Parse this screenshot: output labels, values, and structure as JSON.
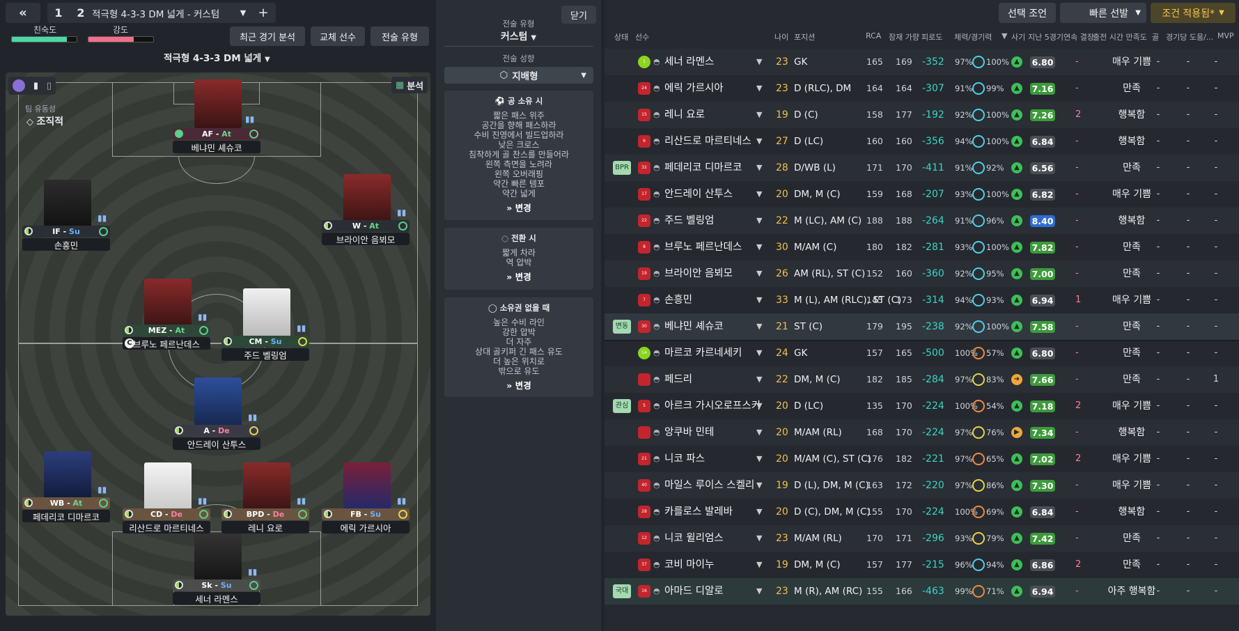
{
  "header": {
    "back_label": "«",
    "tab1": "1",
    "tab2": "2",
    "tactic_title": "적극형 4-3-3 DM 넓게 - 커스텀",
    "add_label": "+"
  },
  "meters": {
    "familiarity_label": "친숙도",
    "familiarity_value": 0.85,
    "intensity_label": "강도",
    "intensity_value": 0.7,
    "familiarity_color": "#4cd7a6",
    "intensity_color": "#ef6f8c"
  },
  "actions": {
    "recent_match": "최근 경기 분석",
    "substitutes": "교체 선수",
    "tactic_style": "전술 유형"
  },
  "formation": {
    "name": "적극형 4-3-3 DM 넓게",
    "analysis_label": "분석",
    "fluidity_label": "팀 유동성",
    "fluidity_value": "조직적"
  },
  "pitch_players": [
    {
      "role": "AF",
      "duty": "At",
      "name": "베냐민 셰슈코",
      "captain": false
    },
    {
      "role": "IF",
      "duty": "Su",
      "name": "손흥민",
      "captain": false
    },
    {
      "role": "W",
      "duty": "At",
      "name": "브라이안 음뵈모",
      "captain": false
    },
    {
      "role": "MEZ",
      "duty": "At",
      "name": "브루노 페르난데스",
      "captain": true
    },
    {
      "role": "CM",
      "duty": "Su",
      "name": "주드 벨링엄",
      "captain": false
    },
    {
      "role": "A",
      "duty": "De",
      "name": "안드레이 산투스",
      "captain": false
    },
    {
      "role": "WB",
      "duty": "At",
      "name": "페데리코 디마르코",
      "captain": false
    },
    {
      "role": "CD",
      "duty": "De",
      "name": "리산드로 마르티네스",
      "captain": false
    },
    {
      "role": "BPD",
      "duty": "De",
      "name": "레니 요로",
      "captain": false
    },
    {
      "role": "FB",
      "duty": "Su",
      "name": "에릭 가르시아",
      "captain": false
    },
    {
      "role": "Sk",
      "duty": "Su",
      "name": "세너 라멘스",
      "captain": false
    }
  ],
  "mid_panel": {
    "close_label": "닫기",
    "tactic_type_label": "전술 유형",
    "tactic_type_value": "커스텀",
    "mentality_label": "전술 성향",
    "mentality_value": "지배형",
    "in_possession": {
      "title": "공 소유 시",
      "items": [
        "짧은 패스 위주",
        "공간을 향해 패스하라",
        "수비 진영에서 빌드업하라",
        "낮은 크로스",
        "침착하게 골 찬스를 만들어라",
        "왼쪽 측면을 노려라",
        "왼쪽 오버래핑",
        "약간 빠른 템포",
        "약간 넓게"
      ],
      "change": "변경"
    },
    "transition": {
      "title": "전환 시",
      "items": [
        "짧게 차라",
        "역 압박"
      ],
      "change": "변경"
    },
    "out_of_possession": {
      "title": "소유권 없을 때",
      "items": [
        "높은 수비 라인",
        "강한 압박",
        "더 자주",
        "상대 골키퍼 긴 패스 유도",
        "더 높은 위치로",
        "밖으로 유도"
      ],
      "change": "변경"
    }
  },
  "top_right": {
    "selection_advice": "선택 조언",
    "quick_pick": "빠른 선발",
    "filter": "조건 적용됨*"
  },
  "table": {
    "headers": [
      "상태",
      "선수",
      "나이",
      "포지션",
      "RCA",
      "잠재 가량",
      "피로도",
      "체력/경기력",
      "사기",
      "지난 5경기",
      "연속 결장",
      "출전 시간 만족도",
      "골",
      "경기당 도움/...",
      "MVP"
    ],
    "rows": [
      {
        "tag": "",
        "num": "1",
        "gk": true,
        "name": "세너 라멘스",
        "age": "23",
        "pos": "GK",
        "rca": "165",
        "pot": "169",
        "fat": "-352",
        "cond": "97%",
        "sharp": "100%",
        "morale": "up",
        "rating": "6.80",
        "rc": "grey",
        "streak": "-",
        "sat": "매우 기쁨",
        "g": "-",
        "a": "-",
        "mvp": "-"
      },
      {
        "tag": "",
        "num": "24",
        "gk": false,
        "name": "에릭 가르시아",
        "age": "23",
        "pos": "D (RLC), DM",
        "rca": "164",
        "pot": "164",
        "fat": "-307",
        "cond": "91%",
        "sharp": "99%",
        "morale": "up",
        "rating": "7.16",
        "rc": "green",
        "streak": "-",
        "sat": "만족",
        "g": "-",
        "a": "-",
        "mvp": "-"
      },
      {
        "tag": "",
        "num": "15",
        "gk": false,
        "name": "레니 요로",
        "age": "19",
        "pos": "D (C)",
        "rca": "158",
        "pot": "177",
        "fat": "-192",
        "cond": "92%",
        "sharp": "100%",
        "morale": "up",
        "rating": "7.26",
        "rc": "green",
        "streak": "2",
        "sat": "행복함",
        "g": "-",
        "a": "-",
        "mvp": "-"
      },
      {
        "tag": "",
        "num": "6",
        "gk": false,
        "name": "리산드로 마르티네스",
        "age": "27",
        "pos": "D (LC)",
        "rca": "160",
        "pot": "160",
        "fat": "-356",
        "cond": "94%",
        "sharp": "100%",
        "morale": "up",
        "rating": "6.84",
        "rc": "grey",
        "streak": "-",
        "sat": "행복함",
        "g": "-",
        "a": "-",
        "mvp": "-"
      },
      {
        "tag": "BPR",
        "num": "32",
        "gk": false,
        "name": "페데리코 디마르코",
        "age": "28",
        "pos": "D/WB (L)",
        "rca": "171",
        "pot": "170",
        "fat": "-411",
        "cond": "91%",
        "sharp": "92%",
        "morale": "up",
        "rating": "6.56",
        "rc": "grey",
        "streak": "-",
        "sat": "만족",
        "g": "-",
        "a": "-",
        "mvp": "-"
      },
      {
        "tag": "",
        "num": "17",
        "gk": false,
        "name": "안드레이 산투스",
        "age": "20",
        "pos": "DM, M (C)",
        "rca": "159",
        "pot": "168",
        "fat": "-207",
        "cond": "93%",
        "sharp": "100%",
        "morale": "up",
        "rating": "6.82",
        "rc": "grey",
        "streak": "-",
        "sat": "매우 기쁨",
        "g": "-",
        "a": "-",
        "mvp": "-"
      },
      {
        "tag": "",
        "num": "22",
        "gk": false,
        "name": "주드 벨링엄",
        "age": "22",
        "pos": "M (LC), AM (C)",
        "rca": "188",
        "pot": "188",
        "fat": "-264",
        "cond": "91%",
        "sharp": "96%",
        "morale": "up",
        "rating": "8.40",
        "rc": "blue",
        "streak": "-",
        "sat": "행복함",
        "g": "-",
        "a": "-",
        "mvp": "-"
      },
      {
        "tag": "",
        "num": "8",
        "gk": false,
        "name": "브루노 페르난데스",
        "age": "30",
        "pos": "M/AM (C)",
        "rca": "180",
        "pot": "182",
        "fat": "-281",
        "cond": "93%",
        "sharp": "100%",
        "morale": "up",
        "rating": "7.82",
        "rc": "green",
        "streak": "-",
        "sat": "만족",
        "g": "-",
        "a": "-",
        "mvp": "-"
      },
      {
        "tag": "",
        "num": "19",
        "gk": false,
        "name": "브라이안 음뵈모",
        "age": "26",
        "pos": "AM (RL), ST (C)",
        "rca": "152",
        "pot": "160",
        "fat": "-360",
        "cond": "92%",
        "sharp": "95%",
        "morale": "up",
        "rating": "7.00",
        "rc": "green",
        "streak": "-",
        "sat": "만족",
        "g": "-",
        "a": "-",
        "mvp": "-"
      },
      {
        "tag": "",
        "num": "7",
        "gk": false,
        "name": "손흥민",
        "age": "33",
        "pos": "M (L), AM (RLC), ST (C)",
        "rca": "145",
        "pot": "173",
        "fat": "-314",
        "cond": "94%",
        "sharp": "93%",
        "morale": "up",
        "rating": "6.94",
        "rc": "grey",
        "streak": "1",
        "sat": "매우 기쁨",
        "g": "-",
        "a": "-",
        "mvp": "-"
      },
      {
        "tag": "변동",
        "num": "30",
        "gk": false,
        "name": "베냐민 셰슈코",
        "age": "21",
        "pos": "ST (C)",
        "rca": "179",
        "pot": "195",
        "fat": "-238",
        "cond": "92%",
        "sharp": "100%",
        "morale": "up",
        "rating": "7.58",
        "rc": "green",
        "streak": "-",
        "sat": "만족",
        "g": "-",
        "a": "-",
        "mvp": "-"
      },
      {
        "tag": "",
        "num": "14",
        "gk": true,
        "name": "마르코 카르네세키",
        "age": "24",
        "pos": "GK",
        "rca": "157",
        "pot": "165",
        "fat": "-500",
        "cond": "100%",
        "sharp": "57%",
        "morale": "up",
        "rating": "6.80",
        "rc": "grey",
        "streak": "-",
        "sat": "만족",
        "g": "-",
        "a": "-",
        "mvp": "-"
      },
      {
        "tag": "",
        "num": "",
        "gk": false,
        "name": "페드리",
        "age": "22",
        "pos": "DM, M (C)",
        "rca": "182",
        "pot": "185",
        "fat": "-284",
        "cond": "97%",
        "sharp": "83%",
        "morale": "ok",
        "rating": "7.66",
        "rc": "green",
        "streak": "-",
        "sat": "만족",
        "g": "-",
        "a": "-",
        "mvp": "1"
      },
      {
        "tag": "관심",
        "num": "5",
        "gk": false,
        "name": "아르크 가시오로프스키",
        "age": "20",
        "pos": "D (LC)",
        "rca": "135",
        "pot": "170",
        "fat": "-224",
        "cond": "100%",
        "sharp": "54%",
        "morale": "up",
        "rating": "7.18",
        "rc": "green",
        "streak": "2",
        "sat": "매우 기쁨",
        "g": "-",
        "a": "-",
        "mvp": "-"
      },
      {
        "tag": "",
        "num": "",
        "gk": false,
        "name": "앙쿠바 민테",
        "age": "20",
        "pos": "M/AM (RL)",
        "rca": "168",
        "pot": "170",
        "fat": "-224",
        "cond": "97%",
        "sharp": "76%",
        "morale": "mid",
        "rating": "7.34",
        "rc": "green",
        "streak": "-",
        "sat": "행복함",
        "g": "-",
        "a": "-",
        "mvp": "-"
      },
      {
        "tag": "",
        "num": "21",
        "gk": false,
        "name": "니코 파스",
        "age": "20",
        "pos": "M/AM (C), ST (C)",
        "rca": "176",
        "pot": "182",
        "fat": "-221",
        "cond": "97%",
        "sharp": "65%",
        "morale": "up",
        "rating": "7.02",
        "rc": "green",
        "streak": "2",
        "sat": "매우 기쁨",
        "g": "-",
        "a": "-",
        "mvp": "-"
      },
      {
        "tag": "",
        "num": "40",
        "gk": false,
        "name": "마일스 루이스 스켈리",
        "age": "19",
        "pos": "D (L), DM, M (C)",
        "rca": "163",
        "pot": "172",
        "fat": "-220",
        "cond": "97%",
        "sharp": "86%",
        "morale": "up",
        "rating": "7.30",
        "rc": "green",
        "streak": "-",
        "sat": "매우 기쁨",
        "g": "-",
        "a": "-",
        "mvp": "-"
      },
      {
        "tag": "",
        "num": "28",
        "gk": false,
        "name": "카를로스 발레바",
        "age": "20",
        "pos": "D (C), DM, M (C)",
        "rca": "155",
        "pot": "170",
        "fat": "-224",
        "cond": "100%",
        "sharp": "69%",
        "morale": "up",
        "rating": "6.84",
        "rc": "grey",
        "streak": "-",
        "sat": "행복함",
        "g": "-",
        "a": "-",
        "mvp": "-"
      },
      {
        "tag": "",
        "num": "12",
        "gk": false,
        "name": "니코 윌리엄스",
        "age": "23",
        "pos": "M/AM (RL)",
        "rca": "170",
        "pot": "171",
        "fat": "-296",
        "cond": "93%",
        "sharp": "79%",
        "morale": "up",
        "rating": "7.42",
        "rc": "green",
        "streak": "-",
        "sat": "만족",
        "g": "-",
        "a": "-",
        "mvp": "-"
      },
      {
        "tag": "",
        "num": "37",
        "gk": false,
        "name": "코비 마이누",
        "age": "19",
        "pos": "DM, M (C)",
        "rca": "157",
        "pot": "177",
        "fat": "-215",
        "cond": "96%",
        "sharp": "94%",
        "morale": "up",
        "rating": "6.86",
        "rc": "grey",
        "streak": "2",
        "sat": "만족",
        "g": "-",
        "a": "-",
        "mvp": "-"
      },
      {
        "tag": "국대",
        "num": "16",
        "gk": false,
        "name": "아마드 디알로",
        "age": "23",
        "pos": "M (R), AM (RC)",
        "rca": "155",
        "pot": "166",
        "fat": "-463",
        "cond": "99%",
        "sharp": "71%",
        "morale": "up",
        "rating": "6.94",
        "rc": "grey",
        "streak": "-",
        "sat": "아주 행복함",
        "g": "-",
        "a": "-",
        "mvp": "-"
      }
    ]
  }
}
